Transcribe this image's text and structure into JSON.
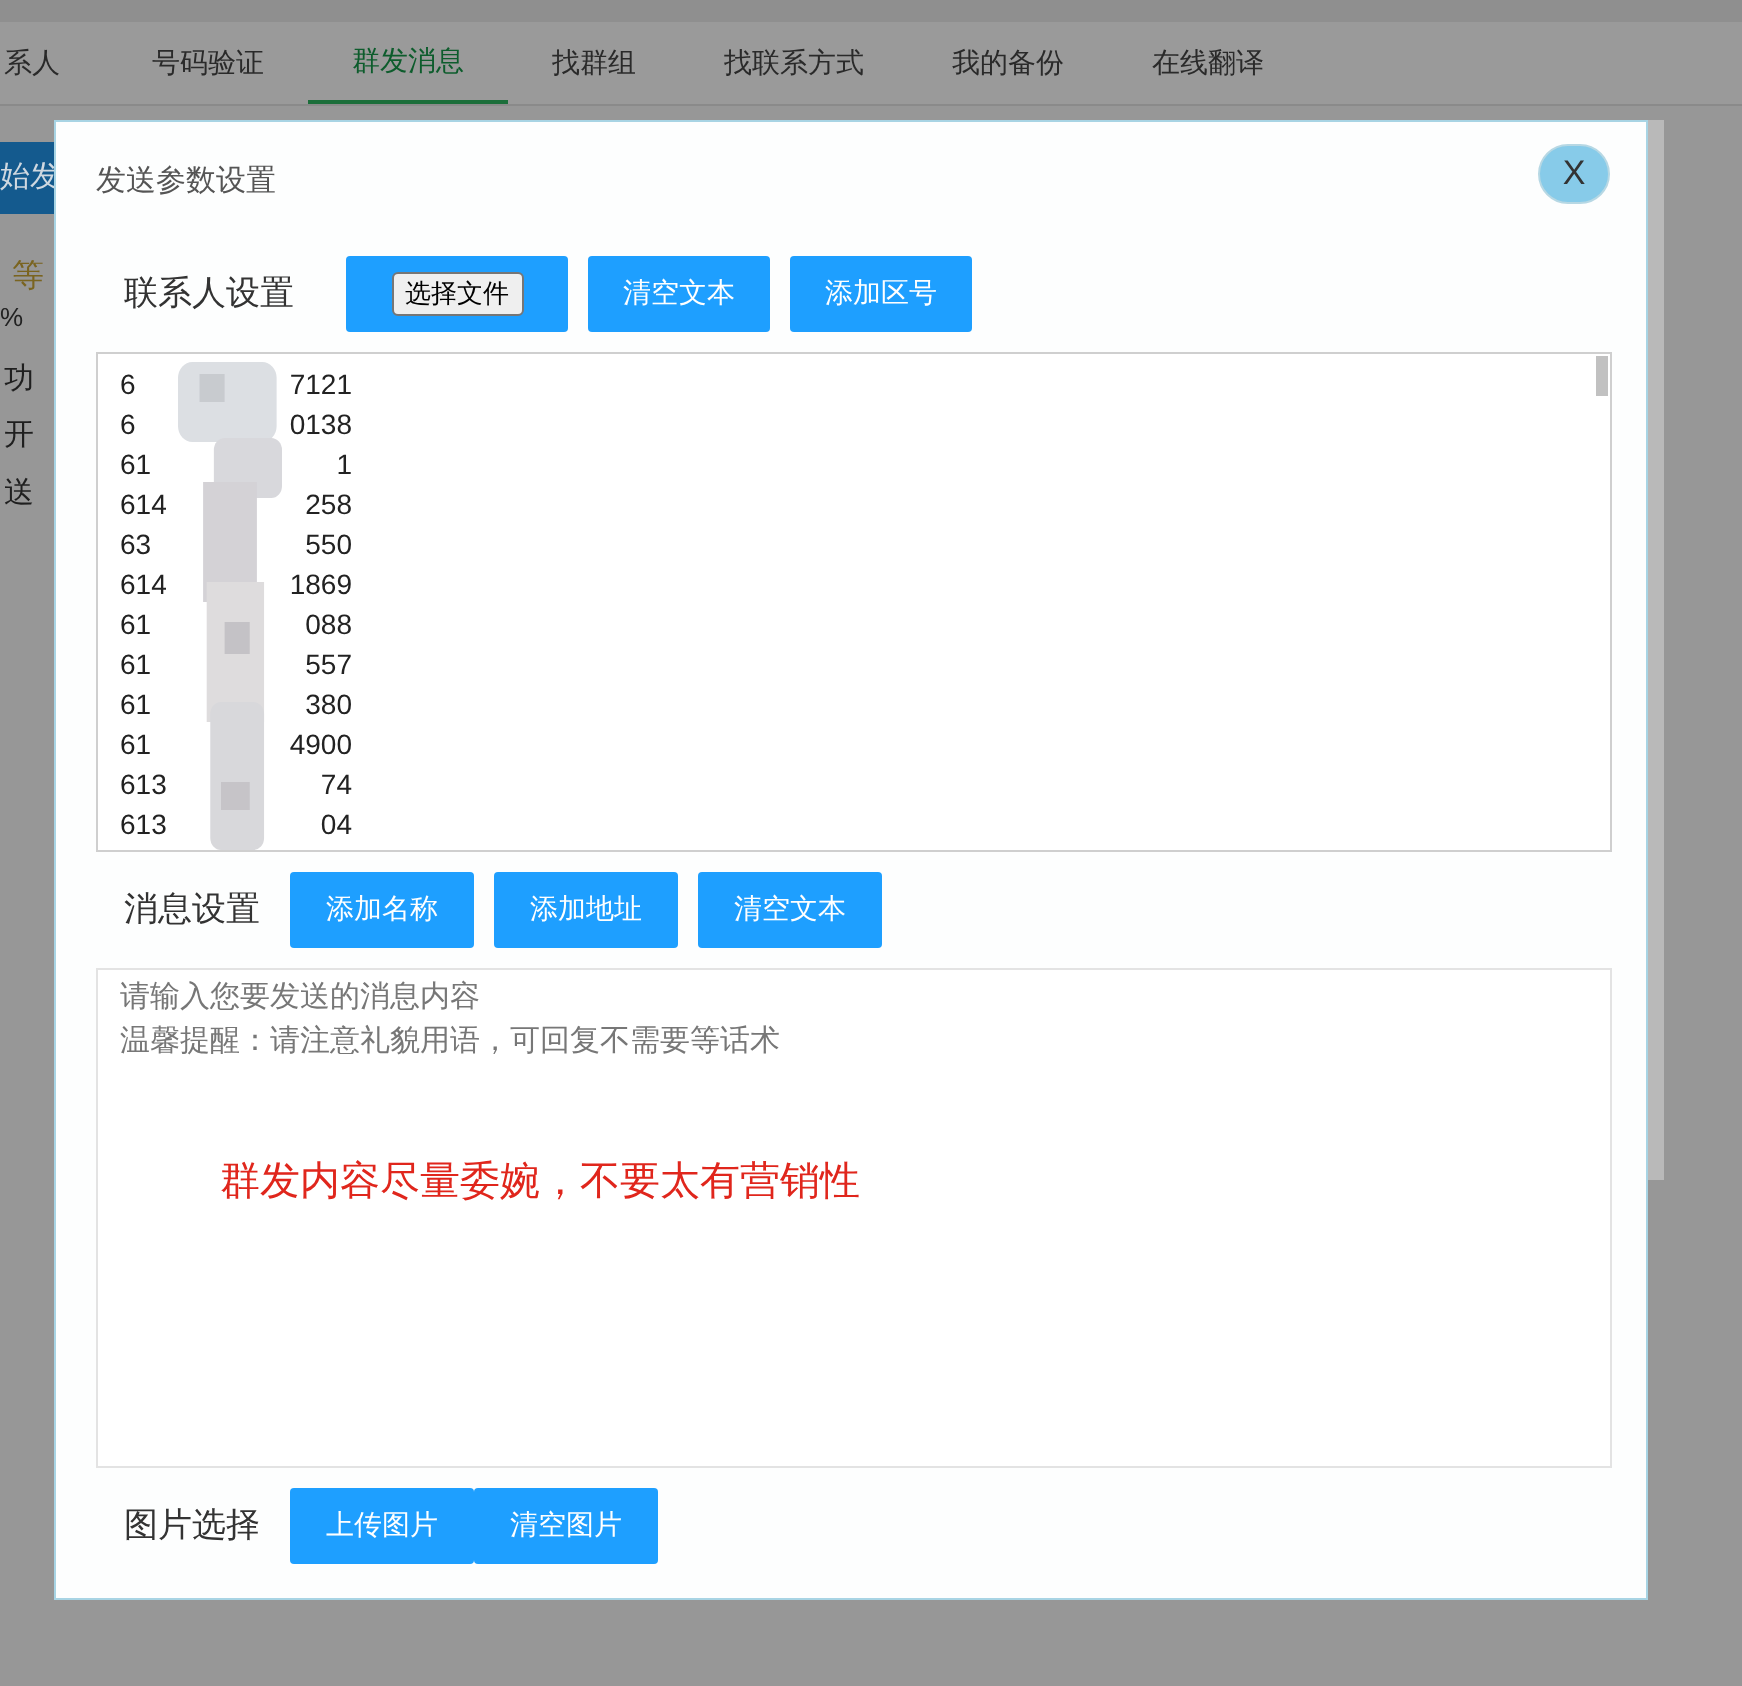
{
  "background": {
    "tabs": [
      {
        "label": "系人",
        "selected": false
      },
      {
        "label": "号码验证",
        "selected": false
      },
      {
        "label": "群发消息",
        "selected": true
      },
      {
        "label": "找群组",
        "selected": false
      },
      {
        "label": "找联系方式",
        "selected": false
      },
      {
        "label": "我的备份",
        "selected": false
      },
      {
        "label": "在线翻译",
        "selected": false
      }
    ],
    "start_button": "始发",
    "status_word": "等",
    "percent": "%",
    "log_lines": [
      "功",
      "开",
      "送"
    ]
  },
  "dialog": {
    "title": "发送参数设置",
    "close": "X",
    "contacts": {
      "label": "联系人设置",
      "file_button": "选择文件",
      "buttons": [
        "清空文本",
        "添加区号"
      ],
      "numbers": [
        {
          "start": "6",
          "end": "7121"
        },
        {
          "start": "6",
          "end": "0138"
        },
        {
          "start": "61",
          "end": "1"
        },
        {
          "start": "614",
          "end": "258"
        },
        {
          "start": "63",
          "end": "550"
        },
        {
          "start": "614",
          "end": "1869"
        },
        {
          "start": "61",
          "end": "088"
        },
        {
          "start": "61",
          "end": "557"
        },
        {
          "start": "61",
          "end": "380"
        },
        {
          "start": "61",
          "end": "4900"
        },
        {
          "start": "613",
          "end": "74"
        },
        {
          "start": "613",
          "end": "04"
        }
      ]
    },
    "message": {
      "label": "消息设置",
      "buttons": [
        "添加名称",
        "添加地址",
        "清空文本"
      ],
      "hint_lines": [
        "请输入您要发送的消息内容",
        "温馨提醒：请注意礼貌用语，可回复不需要等话术"
      ],
      "annotation": "群发内容尽量委婉，不要太有营销性"
    },
    "images": {
      "label": "图片选择",
      "buttons": [
        "上传图片",
        "清空图片"
      ]
    }
  }
}
